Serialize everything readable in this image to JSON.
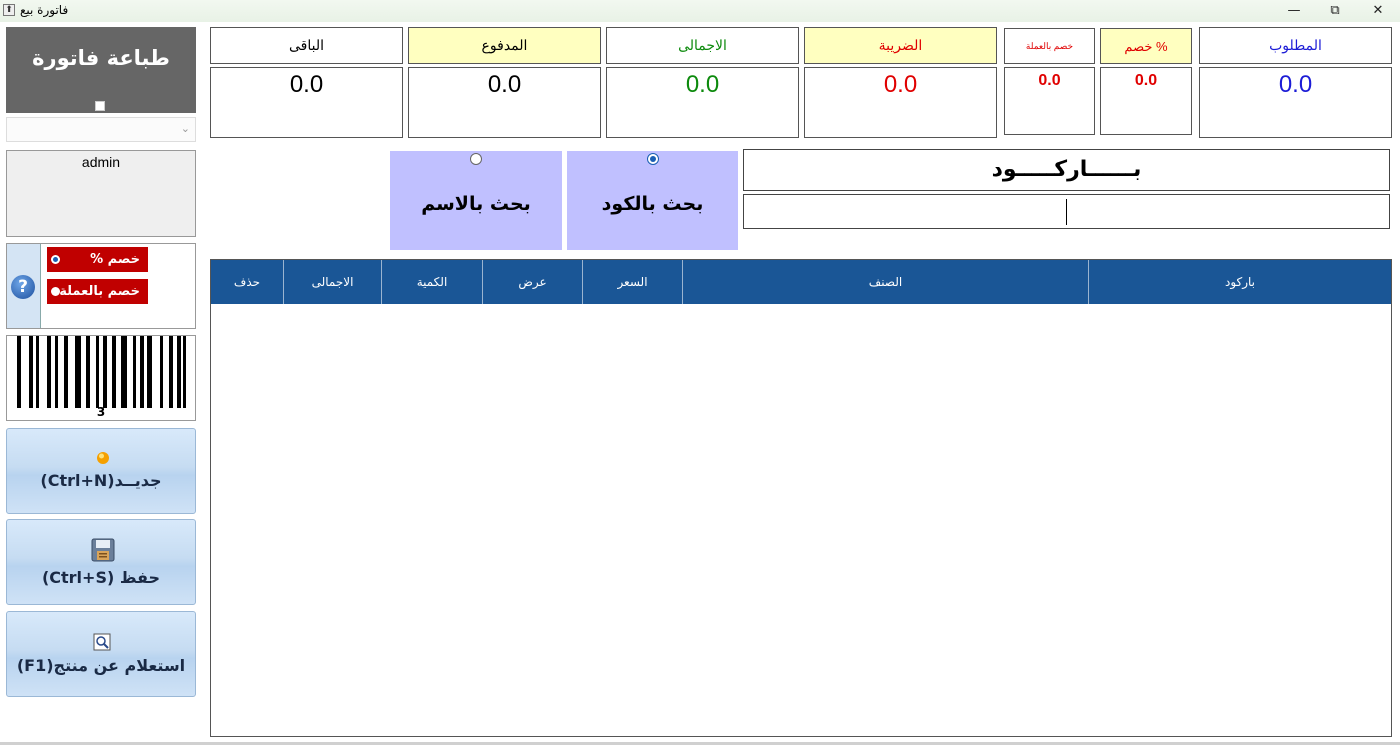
{
  "window": {
    "title": "فاتورة بيع",
    "app_icon": "⬆",
    "minimize": "—",
    "restore": "⧉",
    "close": "✕"
  },
  "totals": {
    "required": {
      "label": "المطلوب",
      "value": "0.0",
      "label_color": "#1c1cd6",
      "value_color": "#1c1cd6"
    },
    "discount_percent": {
      "label": "خصم %",
      "value": "0.0",
      "label_color": "#e00000",
      "value_color": "#e00000"
    },
    "discount_currency": {
      "label": "خصم بالعملة",
      "value": "0.0",
      "label_color": "#e00000",
      "value_color": "#e00000"
    },
    "tax": {
      "label": "الضريبة",
      "value": "0.0",
      "label_color": "#e00000",
      "value_color": "#e00000"
    },
    "total": {
      "label": "الاجمالى",
      "value": "0.0",
      "label_color": "#0c8a0c",
      "value_color": "#0c8a0c"
    },
    "paid": {
      "label": "المدفوع",
      "value": "0.0",
      "label_color": "#000000",
      "value_color": "#000000"
    },
    "remaining": {
      "label": "الباقى",
      "value": "0.0",
      "label_color": "#000000",
      "value_color": "#000000"
    }
  },
  "sidebar": {
    "print_invoice": "طباعة فاتورة",
    "combo_value": "",
    "user": "admin",
    "discount_options": [
      {
        "label": "% خصم",
        "selected": true
      },
      {
        "label": "خصم بالعملة",
        "selected": false
      }
    ],
    "help_icon_glyph": "?",
    "barcode_number": "3",
    "buttons": {
      "new": "(Ctrl+N)جديــد",
      "save": "(Ctrl+S) حفظ",
      "inquiry": "(F1)استعلام عن منتج"
    }
  },
  "search": {
    "by_code": {
      "label": "بحث بالكود",
      "selected": true
    },
    "by_name": {
      "label": "بحث بالاسم",
      "selected": false
    },
    "barcode_title": "بــــــاركـــــود",
    "barcode_value": ""
  },
  "grid": {
    "columns": [
      "باركود",
      "الصنف",
      "السعر",
      "عرض",
      "الكمية",
      "الاجمالى",
      "حذف"
    ],
    "rows": []
  },
  "colors": {
    "grid_header": "#1a5696",
    "search_mode_bg": "#c0c0ff",
    "header_yellow": "#ffffc0",
    "discount_red": "#c00000"
  }
}
